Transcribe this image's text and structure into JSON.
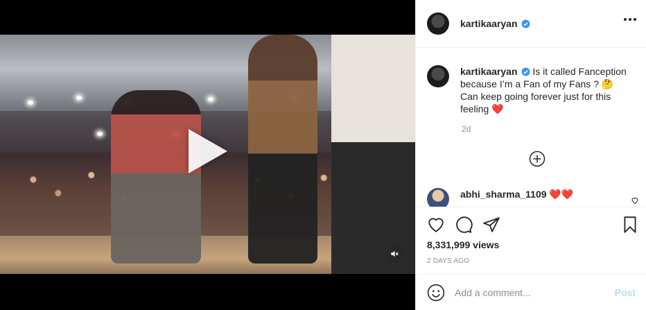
{
  "post": {
    "username": "kartikaaryan",
    "verified": true,
    "caption": "Is it called Fanception because I’m a Fan of my Fans ? 🤔 Can keep going forever just for this feeling ❤️",
    "age": "2d",
    "views": "8,331,999 views",
    "date": "2 DAYS AGO"
  },
  "comments": [
    {
      "username": "abhi_sharma_1109",
      "text": "❤️❤️"
    }
  ],
  "add_comment": {
    "placeholder": "Add a comment...",
    "post_label": "Post"
  },
  "icons": {
    "verified": "verified-badge-icon",
    "more": "more-options-icon",
    "load_more": "plus-circle-icon",
    "like": "heart-icon",
    "comment": "comment-icon",
    "share": "paper-plane-icon",
    "save": "bookmark-icon",
    "emoji": "emoji-icon",
    "mute": "speaker-muted-icon",
    "play": "play-icon"
  },
  "colors": {
    "verified": "#3897f0",
    "post_disabled": "#b2dffc",
    "muted_text": "#8e8e8e"
  }
}
